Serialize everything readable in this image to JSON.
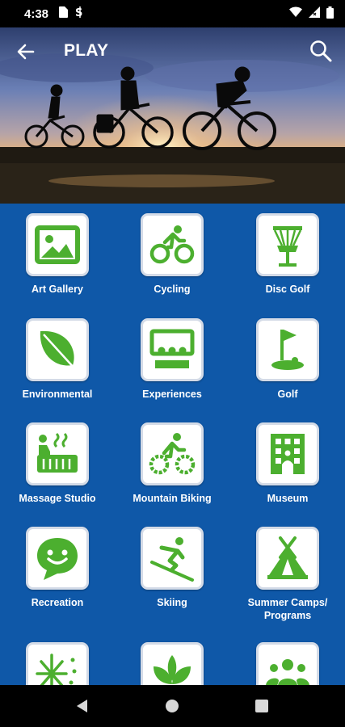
{
  "status_bar": {
    "time": "4:38",
    "icons": [
      "sim-card-icon",
      "data-saver-icon",
      "wifi-icon",
      "signal-icon",
      "battery-icon"
    ]
  },
  "app_bar": {
    "title": "PLAY",
    "back_icon": "arrow-left-icon",
    "search_icon": "search-icon"
  },
  "hero": {
    "description_icon": "cyclists-sunset-banner"
  },
  "colors": {
    "grid_background": "#0f58a8",
    "icon_green": "#4caf2f",
    "tile_white": "#ffffff"
  },
  "categories": [
    {
      "label": "Art Gallery",
      "icon": "image-icon"
    },
    {
      "label": "Cycling",
      "icon": "bike-icon"
    },
    {
      "label": "Disc Golf",
      "icon": "disc-golf-basket-icon"
    },
    {
      "label": "Environmental",
      "icon": "leaf-icon"
    },
    {
      "label": "Experiences",
      "icon": "theater-icon"
    },
    {
      "label": "Golf",
      "icon": "golf-flag-icon"
    },
    {
      "label": "Massage Studio",
      "icon": "hot-tub-icon"
    },
    {
      "label": "Mountain Biking",
      "icon": "mountain-bike-icon"
    },
    {
      "label": "Museum",
      "icon": "building-icon"
    },
    {
      "label": "Recreation",
      "icon": "smile-chat-icon"
    },
    {
      "label": "Skiing",
      "icon": "skier-icon"
    },
    {
      "label": "Summer Camps/\nPrograms",
      "icon": "tent-icon"
    },
    {
      "label": "",
      "icon": "snowflake-icon"
    },
    {
      "label": "",
      "icon": "spa-lotus-icon"
    },
    {
      "label": "",
      "icon": "group-icon"
    }
  ],
  "nav_bar": {
    "back": "triangle-back-icon",
    "home": "circle-home-icon",
    "recents": "square-recents-icon"
  }
}
